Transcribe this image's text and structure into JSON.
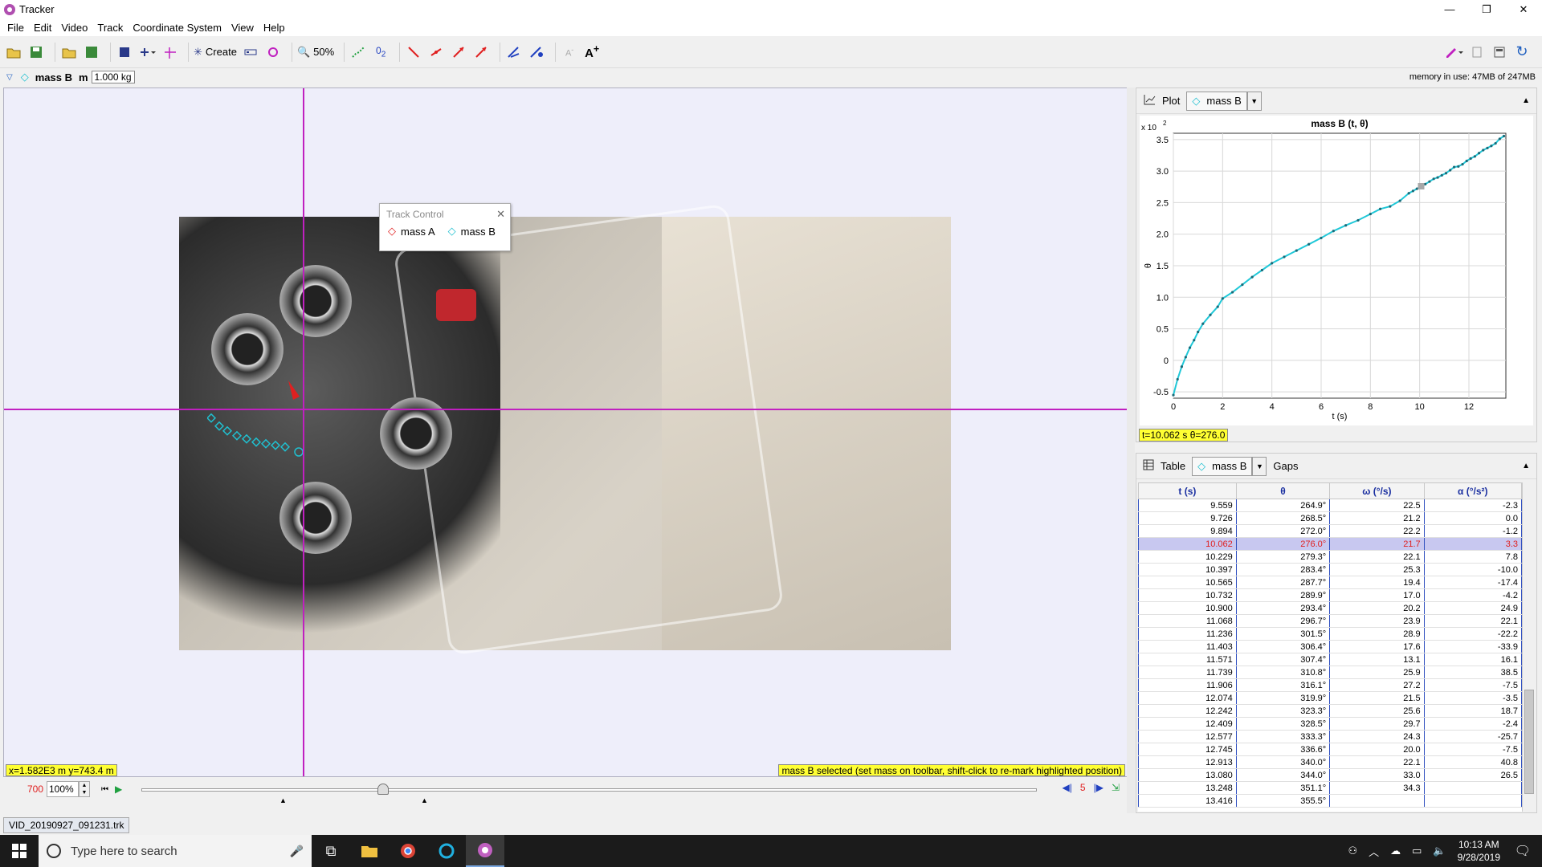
{
  "window": {
    "title": "Tracker",
    "min": "—",
    "restore": "❐",
    "close": "✕"
  },
  "menu": [
    "File",
    "Edit",
    "Video",
    "Track",
    "Coordinate System",
    "View",
    "Help"
  ],
  "toolbar": {
    "create_label": "Create",
    "zoom_label": "50%"
  },
  "trackbar": {
    "track_name": "mass B",
    "mass_label": "m",
    "mass_value": "1.000 kg",
    "memory": "memory in use: 47MB of 247MB"
  },
  "track_control": {
    "title": "Track Control",
    "close": "✕",
    "tracks": [
      "mass A",
      "mass B"
    ]
  },
  "viewer": {
    "coord_readout": "x=1.582E3 m  y=743.4 m",
    "status": "mass B selected (set mass on toolbar, shift-click to re-mark highlighted position)"
  },
  "player": {
    "frame": "700",
    "zoom": "100%",
    "step": "5"
  },
  "file_tab": "VID_20190927_091231.trk",
  "plot": {
    "label": "Plot",
    "track": "mass B",
    "readout": "t=10.062 s  θ=276.0",
    "chart_data": {
      "type": "line",
      "title": "mass B (t, θ)",
      "xlabel": "t (s)",
      "ylabel": "θ",
      "yscale_label": "x 10",
      "yscale_exp": "2",
      "xlim": [
        0,
        13.5
      ],
      "ylim": [
        -0.6,
        3.6
      ],
      "xticks": [
        0,
        2,
        4,
        6,
        8,
        10,
        12
      ],
      "yticks": [
        -0.5,
        0,
        0.5,
        1.0,
        1.5,
        2.0,
        2.5,
        3.0,
        3.5
      ],
      "grid": true,
      "color": "#20c8d8",
      "x": [
        0,
        0.17,
        0.34,
        0.5,
        0.67,
        0.84,
        1.0,
        1.2,
        1.5,
        1.8,
        2.0,
        2.4,
        2.8,
        3.2,
        3.6,
        4.0,
        4.5,
        5.0,
        5.5,
        6.0,
        6.5,
        7.0,
        7.5,
        8.0,
        8.4,
        8.8,
        9.2,
        9.56,
        9.73,
        9.89,
        10.06,
        10.23,
        10.4,
        10.57,
        10.73,
        10.9,
        11.07,
        11.24,
        11.4,
        11.57,
        11.74,
        11.91,
        12.07,
        12.24,
        12.41,
        12.58,
        12.75,
        12.91,
        13.08,
        13.25,
        13.42
      ],
      "y": [
        -0.55,
        -0.3,
        -0.1,
        0.05,
        0.2,
        0.32,
        0.45,
        0.58,
        0.72,
        0.85,
        0.98,
        1.08,
        1.2,
        1.32,
        1.43,
        1.54,
        1.64,
        1.74,
        1.84,
        1.94,
        2.05,
        2.14,
        2.22,
        2.32,
        2.4,
        2.44,
        2.53,
        2.649,
        2.685,
        2.72,
        2.76,
        2.793,
        2.834,
        2.877,
        2.899,
        2.934,
        2.967,
        3.015,
        3.064,
        3.074,
        3.108,
        3.161,
        3.199,
        3.233,
        3.285,
        3.333,
        3.366,
        3.4,
        3.44,
        3.511,
        3.555
      ]
    }
  },
  "table": {
    "label": "Table",
    "track": "mass B",
    "gaps_label": "Gaps",
    "headers": [
      "t (s)",
      "θ",
      "ω (°/s)",
      "α (°/s²)"
    ],
    "rows": [
      [
        "9.559",
        "264.9°",
        "22.5",
        "-2.3"
      ],
      [
        "9.726",
        "268.5°",
        "21.2",
        "0.0"
      ],
      [
        "9.894",
        "272.0°",
        "22.2",
        "-1.2"
      ],
      [
        "10.062",
        "276.0°",
        "21.7",
        "3.3"
      ],
      [
        "10.229",
        "279.3°",
        "22.1",
        "7.8"
      ],
      [
        "10.397",
        "283.4°",
        "25.3",
        "-10.0"
      ],
      [
        "10.565",
        "287.7°",
        "19.4",
        "-17.4"
      ],
      [
        "10.732",
        "289.9°",
        "17.0",
        "-4.2"
      ],
      [
        "10.900",
        "293.4°",
        "20.2",
        "24.9"
      ],
      [
        "11.068",
        "296.7°",
        "23.9",
        "22.1"
      ],
      [
        "11.236",
        "301.5°",
        "28.9",
        "-22.2"
      ],
      [
        "11.403",
        "306.4°",
        "17.6",
        "-33.9"
      ],
      [
        "11.571",
        "307.4°",
        "13.1",
        "16.1"
      ],
      [
        "11.739",
        "310.8°",
        "25.9",
        "38.5"
      ],
      [
        "11.906",
        "316.1°",
        "27.2",
        "-7.5"
      ],
      [
        "12.074",
        "319.9°",
        "21.5",
        "-3.5"
      ],
      [
        "12.242",
        "323.3°",
        "25.6",
        "18.7"
      ],
      [
        "12.409",
        "328.5°",
        "29.7",
        "-2.4"
      ],
      [
        "12.577",
        "333.3°",
        "24.3",
        "-25.7"
      ],
      [
        "12.745",
        "336.6°",
        "20.0",
        "-7.5"
      ],
      [
        "12.913",
        "340.0°",
        "22.1",
        "40.8"
      ],
      [
        "13.080",
        "344.0°",
        "33.0",
        "26.5"
      ],
      [
        "13.248",
        "351.1°",
        "34.3",
        ""
      ],
      [
        "13.416",
        "355.5°",
        "",
        ""
      ]
    ],
    "selected_index": 3
  },
  "taskbar": {
    "search_placeholder": "Type here to search",
    "time": "10:13 AM",
    "date": "9/28/2019"
  }
}
